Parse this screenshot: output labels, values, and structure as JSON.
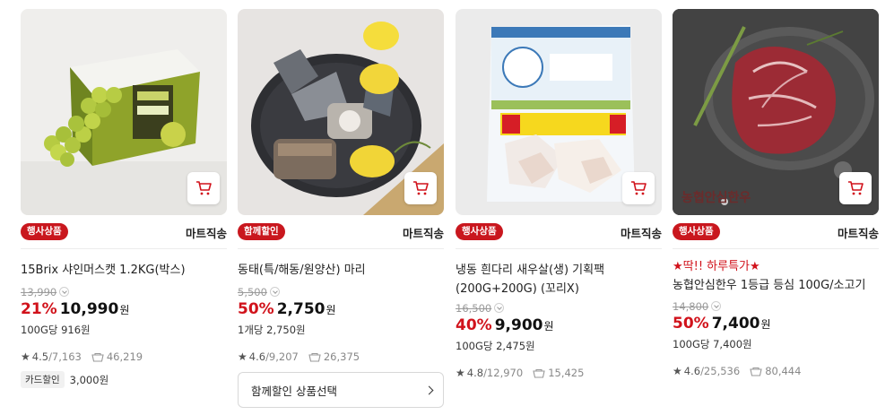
{
  "products": [
    {
      "badge": "행사상품",
      "shipping": "마트직송",
      "promo": "",
      "name": "15Brix 샤인머스캣 1.2KG(박스)",
      "original_price": "13,990",
      "discount_pct": "21%",
      "price": "10,990",
      "currency": "원",
      "unit_price": "100G당 916원",
      "rating": "4.5",
      "reviews": "/7,163",
      "purchases": "46,219",
      "card_discount_label": "카드할인",
      "card_discount_value": "3,000원",
      "image_icon": "shine-muscat-grape-box-image"
    },
    {
      "badge": "함께할인",
      "shipping": "마트직송",
      "promo": "",
      "name": "동태(특/해동/원양산) 마리",
      "original_price": "5,500",
      "discount_pct": "50%",
      "price": "2,750",
      "currency": "원",
      "unit_price": "1개당 2,750원",
      "rating": "4.6",
      "reviews": "/9,207",
      "purchases": "26,375",
      "option_button": "함께할인 상품선택",
      "image_icon": "frozen-pollock-plate-image"
    },
    {
      "badge": "행사상품",
      "shipping": "마트직송",
      "promo": "",
      "name": "냉동 흰다리 새우살(생) 기획팩(200G+200G) (꼬리X)",
      "original_price": "16,500",
      "discount_pct": "40%",
      "price": "9,900",
      "currency": "원",
      "unit_price": "100G당 2,475원",
      "rating": "4.8",
      "reviews": "/12,970",
      "purchases": "15,425",
      "image_icon": "frozen-shrimp-bag-image"
    },
    {
      "badge": "행사상품",
      "shipping": "마트직송",
      "promo": "★딱!! 하루특가★",
      "name": "농협안심한우 1등급 등심 100G/소고기",
      "original_price": "14,800",
      "discount_pct": "50%",
      "price": "7,400",
      "currency": "원",
      "unit_price": "100G당 7,400원",
      "rating": "4.6",
      "reviews": "/25,536",
      "purchases": "80,444",
      "image_logo_text": "농협안심한우",
      "image_icon": "hanwoo-beef-sirloin-image"
    }
  ],
  "colors": {
    "accent": "#c9171e",
    "price_red": "#d1121b"
  },
  "icons": {
    "cart": "shopping-cart-icon",
    "star": "star-icon",
    "buy": "purchase-bag-icon"
  }
}
